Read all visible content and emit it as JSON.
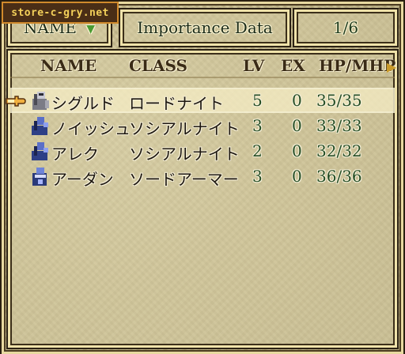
{
  "watermark": "store-c-gry.net",
  "header": {
    "sort_label": "NAME",
    "sort_icon": "triangle-down-icon",
    "title": "Importance Data",
    "page": "1/6"
  },
  "table": {
    "columns": [
      "NAME",
      "CLASS",
      "LV",
      "EX",
      "HP/MHP"
    ],
    "selected_index": 0,
    "rows": [
      {
        "name": "シグルド",
        "class": "ロードナイト",
        "lv": "5",
        "ex": "0",
        "hp": "35/35",
        "sprite": "lord-knight-sprite-icon"
      },
      {
        "name": "ノイッシュ",
        "class": "ソシアルナイト",
        "lv": "3",
        "ex": "0",
        "hp": "33/33",
        "sprite": "social-knight-sprite-icon"
      },
      {
        "name": "アレク",
        "class": "ソシアルナイト",
        "lv": "2",
        "ex": "0",
        "hp": "32/32",
        "sprite": "social-knight-sprite-icon"
      },
      {
        "name": "アーダン",
        "class": "ソードアーマー",
        "lv": "3",
        "ex": "0",
        "hp": "36/36",
        "sprite": "sword-armor-sprite-icon"
      }
    ]
  },
  "colors": {
    "background": "#c8bc8e",
    "number_green": "#244d24",
    "accent_gold": "#c99a2b"
  }
}
